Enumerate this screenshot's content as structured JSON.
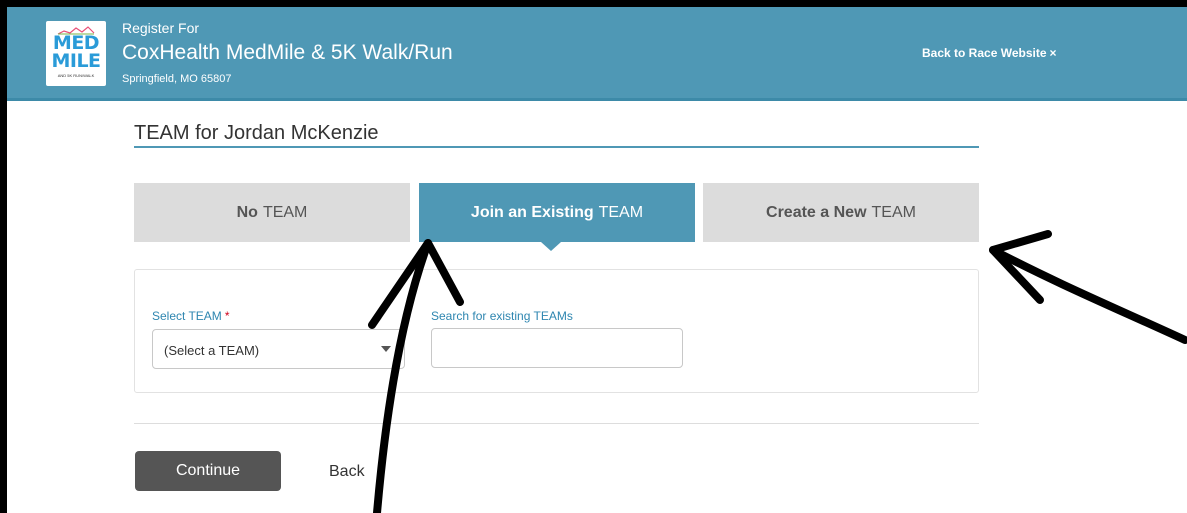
{
  "header": {
    "logo": {
      "line1": "MED",
      "line2": "MILE",
      "sub": "AND 5K RUN/WALK"
    },
    "register_for": "Register For",
    "race_title": "CoxHealth MedMile & 5K Walk/Run",
    "location": "Springfield, MO 65807",
    "back_link": "Back to Race Website",
    "back_icon": "×"
  },
  "section": {
    "title": "TEAM for Jordan McKenzie"
  },
  "tabs": [
    {
      "bold": "No",
      "rest": "TEAM",
      "active": false
    },
    {
      "bold": "Join an Existing",
      "rest": "TEAM",
      "active": true
    },
    {
      "bold": "Create a New",
      "rest": "TEAM",
      "active": false
    }
  ],
  "form": {
    "select_label": "Select TEAM",
    "required_mark": "*",
    "select_value": "(Select a TEAM)",
    "search_label": "Search for existing TEAMs",
    "search_value": "",
    "search_placeholder": ""
  },
  "actions": {
    "continue_label": "Continue",
    "back_label": "Back"
  },
  "colors": {
    "header_bg": "#4f98b5",
    "active_tab": "#4f98b5",
    "inactive_tab": "#dcdcdc",
    "continue_button": "#555555",
    "required": "#d0021b",
    "annotation": "#000000"
  },
  "icons": {
    "close": "x-icon",
    "select_arrow": "caret-down-icon"
  }
}
